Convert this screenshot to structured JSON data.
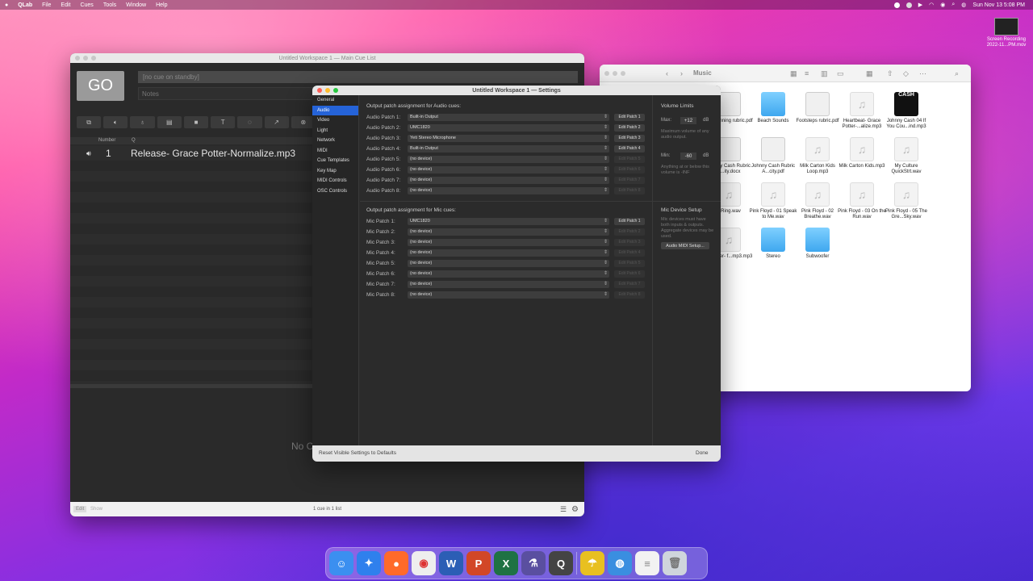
{
  "menubar": {
    "app": "QLab",
    "items": [
      "File",
      "Edit",
      "Cues",
      "Tools",
      "Window",
      "Help"
    ],
    "clock": "Sun Nov 13  5:08 PM"
  },
  "desktop": {
    "screen_recording_label1": "Screen Recording",
    "screen_recording_label2": "2022-11...PM.mov"
  },
  "main_window": {
    "title": "Untitled Workspace 1 — Main Cue List",
    "go_label": "GO",
    "standby_placeholder": "[no cue on standby]",
    "notes_placeholder": "Notes",
    "col_number": "Number",
    "col_q": "Q",
    "cue": {
      "number": "1",
      "name": "Release- Grace Potter-Normalize.mp3"
    },
    "no_cue_text": "No C",
    "edit_label": "Edit",
    "show_label": "Show",
    "status": "1 cue in 1 list"
  },
  "finder": {
    "title": "Music",
    "items": [
      {
        "name": "city Panning rubric.pdf",
        "kind": "doc"
      },
      {
        "name": "Beach Sounds",
        "kind": "folder"
      },
      {
        "name": "Footsteps rubric.pdf",
        "kind": "doc"
      },
      {
        "name": "Heartbeat- Grace Potter-...alize.mp3",
        "kind": "audio"
      },
      {
        "name": "Johnny Cash 04 If You Cou...ind.mp3",
        "kind": "art"
      },
      {
        "name": "Johnny Cash Rubric A...ity.docx",
        "kind": "doc"
      },
      {
        "name": "Johnny Cash Rubric A...city.pdf",
        "kind": "doc"
      },
      {
        "name": "Milk Carton Kids Loop.mp3",
        "kind": "audio"
      },
      {
        "name": "Milk Carton Kids.mp3",
        "kind": "audio"
      },
      {
        "name": "My Culture QuickStrt.wav",
        "kind": "audio"
      },
      {
        "name": "e Ring.wav",
        "kind": "audio"
      },
      {
        "name": "Pink Floyd - 01 Speak to Me.wav",
        "kind": "audio"
      },
      {
        "name": "Pink Floyd - 02 Breathe.wav",
        "kind": "audio"
      },
      {
        "name": "Pink Floyd - 03 On the Run.wav",
        "kind": "audio"
      },
      {
        "name": "Pink Floyd - 05 The Gre...Sky.wav",
        "kind": "audio"
      },
      {
        "name": "ie Foster- f...mp3.mp3",
        "kind": "audio"
      },
      {
        "name": "Stereo",
        "kind": "folder"
      },
      {
        "name": "Subwoofer",
        "kind": "folder"
      }
    ],
    "album_text": "CASH"
  },
  "settings": {
    "title": "Untitled Workspace 1 — Settings",
    "sidebar": [
      "General",
      "Audio",
      "Video",
      "Light",
      "Network",
      "MIDI",
      "Cue Templates",
      "Key Map",
      "MIDI Controls",
      "OSC Controls"
    ],
    "selected": "Audio",
    "audio_heading": "Output patch assignment for Audio cues:",
    "audio_patches": [
      {
        "label": "Audio Patch 1:",
        "device": "Built-in Output",
        "edit": "Edit Patch 1",
        "enabled": true
      },
      {
        "label": "Audio Patch 2:",
        "device": "UMC1820",
        "edit": "Edit Patch 2",
        "enabled": true
      },
      {
        "label": "Audio Patch 3:",
        "device": "Yeti Stereo Microphone",
        "edit": "Edit Patch 3",
        "enabled": true
      },
      {
        "label": "Audio Patch 4:",
        "device": "Built-in Output",
        "edit": "Edit Patch 4",
        "enabled": true
      },
      {
        "label": "Audio Patch 5:",
        "device": "(no device)",
        "edit": "Edit Patch 5",
        "enabled": false
      },
      {
        "label": "Audio Patch 6:",
        "device": "(no device)",
        "edit": "Edit Patch 6",
        "enabled": false
      },
      {
        "label": "Audio Patch 7:",
        "device": "(no device)",
        "edit": "Edit Patch 7",
        "enabled": false
      },
      {
        "label": "Audio Patch 8:",
        "device": "(no device)",
        "edit": "Edit Patch 8",
        "enabled": false
      }
    ],
    "mic_heading": "Output patch assignment for Mic cues:",
    "mic_patches": [
      {
        "label": "Mic Patch 1:",
        "device": "UMC1820",
        "edit": "Edit Patch 1",
        "enabled": true
      },
      {
        "label": "Mic Patch 2:",
        "device": "(no device)",
        "edit": "Edit Patch 2",
        "enabled": false
      },
      {
        "label": "Mic Patch 3:",
        "device": "(no device)",
        "edit": "Edit Patch 3",
        "enabled": false
      },
      {
        "label": "Mic Patch 4:",
        "device": "(no device)",
        "edit": "Edit Patch 4",
        "enabled": false
      },
      {
        "label": "Mic Patch 5:",
        "device": "(no device)",
        "edit": "Edit Patch 5",
        "enabled": false
      },
      {
        "label": "Mic Patch 6:",
        "device": "(no device)",
        "edit": "Edit Patch 6",
        "enabled": false
      },
      {
        "label": "Mic Patch 7:",
        "device": "(no device)",
        "edit": "Edit Patch 7",
        "enabled": false
      },
      {
        "label": "Mic Patch 8:",
        "device": "(no device)",
        "edit": "Edit Patch 8",
        "enabled": false
      }
    ],
    "volume": {
      "heading": "Volume Limits",
      "max_label": "Max:",
      "max_value": "+12",
      "unit": "dB",
      "max_hint": "Maximum volume of any audio output.",
      "min_label": "Min:",
      "min_value": "-60",
      "min_hint": "Anything at or below this volume is -INF"
    },
    "mic_setup": {
      "heading": "Mic Device Setup",
      "hint": "Mic devices must have both inputs & outputs. Aggregate devices may be used.",
      "button": "Audio MIDI Setup..."
    },
    "reset_label": "Reset Visible Settings to Defaults",
    "done_label": "Done"
  },
  "dock": [
    "Finder",
    "Safari",
    "Firefox",
    "Chrome",
    "Word",
    "PowerPoint",
    "Excel",
    "QLab",
    "QuickTime",
    "Fetch",
    "Globe",
    "TextEdit",
    "Trash"
  ]
}
